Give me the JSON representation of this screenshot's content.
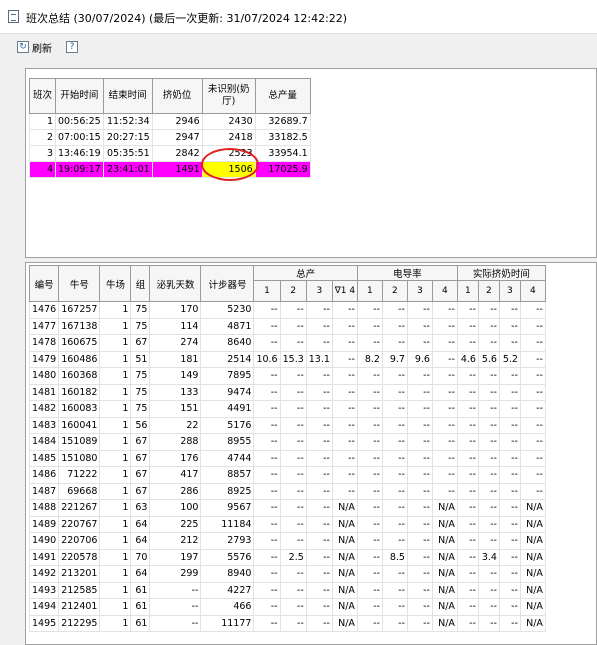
{
  "window": {
    "title": "班次总结 (30/07/2024) (最后一次更新: 31/07/2024 12:42:22)"
  },
  "toolbar": {
    "refresh_label": "刷新",
    "help_icon": "help-icon",
    "refresh_icon": "refresh-icon"
  },
  "shift_table": {
    "headers": [
      "班次",
      "开始时间",
      "结束时间",
      "挤奶位",
      "未识别(奶厅)",
      "总产量"
    ],
    "rows": [
      [
        "1",
        "00:56:25",
        "11:52:34",
        "2946",
        "2430",
        "32689.7"
      ],
      [
        "2",
        "07:00:15",
        "20:27:15",
        "2947",
        "2418",
        "33182.5"
      ],
      [
        "3",
        "13:46:19",
        "05:35:51",
        "2842",
        "2523",
        "33954.1"
      ],
      [
        "4",
        "19:09:17",
        "23:41:01",
        "1491",
        "1506",
        "17025.9"
      ]
    ],
    "selected_row_color": "#ff00ff",
    "highlight_color": "#ffff00",
    "circle_color": "#e02020"
  },
  "cow_table": {
    "headers": [
      "编号",
      "牛号",
      "牛场",
      "组",
      "泌乳天数",
      "计步器号"
    ],
    "groups": [
      "总产",
      "电导率",
      "实际挤奶时间"
    ],
    "sub_total": [
      "1",
      "2",
      "3",
      "∇1 4"
    ],
    "sub_cond": [
      "1",
      "2",
      "3",
      "4"
    ],
    "sub_time": [
      "1",
      "2",
      "3",
      "4"
    ],
    "rows": [
      [
        "1476",
        "167257",
        "1",
        "75",
        "170",
        "5230",
        "--",
        "--",
        "--",
        "--",
        "--",
        "--",
        "--",
        "--",
        "--",
        "--",
        "--",
        "--"
      ],
      [
        "1477",
        "167138",
        "1",
        "75",
        "114",
        "4871",
        "--",
        "--",
        "--",
        "--",
        "--",
        "--",
        "--",
        "--",
        "--",
        "--",
        "--",
        "--"
      ],
      [
        "1478",
        "160675",
        "1",
        "67",
        "274",
        "8640",
        "--",
        "--",
        "--",
        "--",
        "--",
        "--",
        "--",
        "--",
        "--",
        "--",
        "--",
        "--"
      ],
      [
        "1479",
        "160486",
        "1",
        "51",
        "181",
        "2514",
        "10.6",
        "15.3",
        "13.1",
        "--",
        "8.2",
        "9.7",
        "9.6",
        "--",
        "4.6",
        "5.6",
        "5.2",
        "--"
      ],
      [
        "1480",
        "160368",
        "1",
        "75",
        "149",
        "7895",
        "--",
        "--",
        "--",
        "--",
        "--",
        "--",
        "--",
        "--",
        "--",
        "--",
        "--",
        "--"
      ],
      [
        "1481",
        "160182",
        "1",
        "75",
        "133",
        "9474",
        "--",
        "--",
        "--",
        "--",
        "--",
        "--",
        "--",
        "--",
        "--",
        "--",
        "--",
        "--"
      ],
      [
        "1482",
        "160083",
        "1",
        "75",
        "151",
        "4491",
        "--",
        "--",
        "--",
        "--",
        "--",
        "--",
        "--",
        "--",
        "--",
        "--",
        "--",
        "--"
      ],
      [
        "1483",
        "160041",
        "1",
        "56",
        "22",
        "5176",
        "--",
        "--",
        "--",
        "--",
        "--",
        "--",
        "--",
        "--",
        "--",
        "--",
        "--",
        "--"
      ],
      [
        "1484",
        "151089",
        "1",
        "67",
        "288",
        "8955",
        "--",
        "--",
        "--",
        "--",
        "--",
        "--",
        "--",
        "--",
        "--",
        "--",
        "--",
        "--"
      ],
      [
        "1485",
        "151080",
        "1",
        "67",
        "176",
        "4744",
        "--",
        "--",
        "--",
        "--",
        "--",
        "--",
        "--",
        "--",
        "--",
        "--",
        "--",
        "--"
      ],
      [
        "1486",
        "71222",
        "1",
        "67",
        "417",
        "8857",
        "--",
        "--",
        "--",
        "--",
        "--",
        "--",
        "--",
        "--",
        "--",
        "--",
        "--",
        "--"
      ],
      [
        "1487",
        "69668",
        "1",
        "67",
        "286",
        "8925",
        "--",
        "--",
        "--",
        "--",
        "--",
        "--",
        "--",
        "--",
        "--",
        "--",
        "--",
        "--"
      ],
      [
        "1488",
        "221267",
        "1",
        "63",
        "100",
        "9567",
        "--",
        "--",
        "--",
        "N/A",
        "--",
        "--",
        "--",
        "N/A",
        "--",
        "--",
        "--",
        "N/A"
      ],
      [
        "1489",
        "220767",
        "1",
        "64",
        "225",
        "11184",
        "--",
        "--",
        "--",
        "N/A",
        "--",
        "--",
        "--",
        "N/A",
        "--",
        "--",
        "--",
        "N/A"
      ],
      [
        "1490",
        "220706",
        "1",
        "64",
        "212",
        "2793",
        "--",
        "--",
        "--",
        "N/A",
        "--",
        "--",
        "--",
        "N/A",
        "--",
        "--",
        "--",
        "N/A"
      ],
      [
        "1491",
        "220578",
        "1",
        "70",
        "197",
        "5576",
        "--",
        "2.5",
        "--",
        "N/A",
        "--",
        "8.5",
        "--",
        "N/A",
        "--",
        "3.4",
        "--",
        "N/A"
      ],
      [
        "1492",
        "213201",
        "1",
        "64",
        "299",
        "8940",
        "--",
        "--",
        "--",
        "N/A",
        "--",
        "--",
        "--",
        "N/A",
        "--",
        "--",
        "--",
        "N/A"
      ],
      [
        "1493",
        "212585",
        "1",
        "61",
        "--",
        "4227",
        "--",
        "--",
        "--",
        "N/A",
        "--",
        "--",
        "--",
        "N/A",
        "--",
        "--",
        "--",
        "N/A"
      ],
      [
        "1494",
        "212401",
        "1",
        "61",
        "--",
        "466",
        "--",
        "--",
        "--",
        "N/A",
        "--",
        "--",
        "--",
        "N/A",
        "--",
        "--",
        "--",
        "N/A"
      ],
      [
        "1495",
        "212295",
        "1",
        "61",
        "--",
        "11177",
        "--",
        "--",
        "--",
        "N/A",
        "--",
        "--",
        "--",
        "N/A",
        "--",
        "--",
        "--",
        "N/A"
      ]
    ]
  }
}
